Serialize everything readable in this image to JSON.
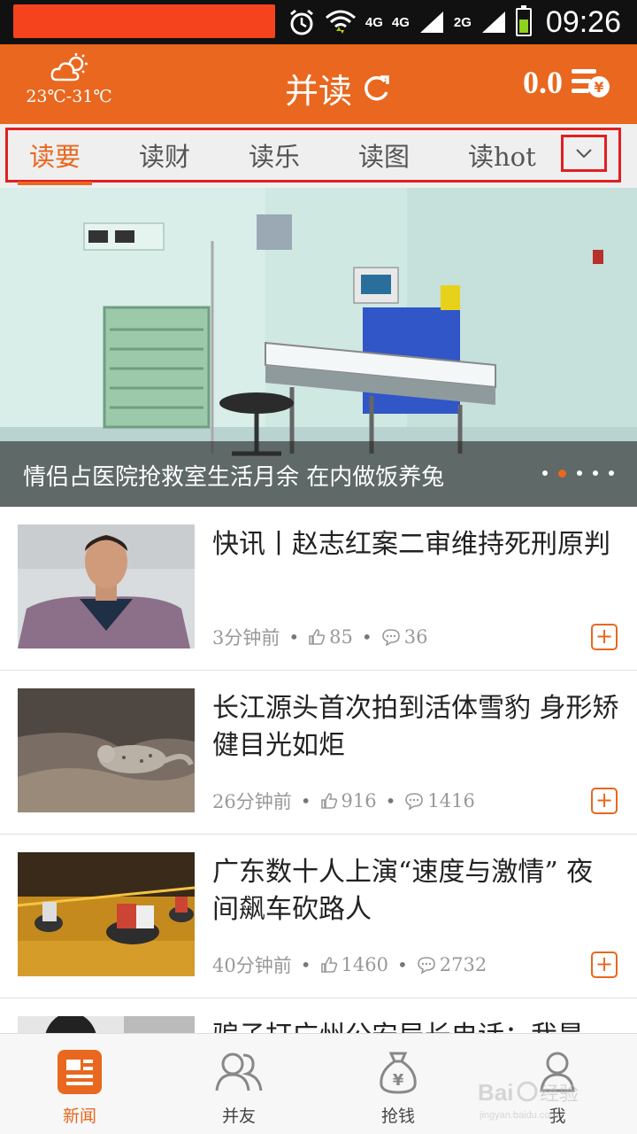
{
  "status_bar": {
    "network_1": "4G",
    "network_2": "4G",
    "network_3": "2G",
    "time": "09:26",
    "icons": [
      "alarm-icon",
      "wifi-icon",
      "signal-icon",
      "battery-icon"
    ]
  },
  "header": {
    "weather_temp": "23℃-31℃",
    "app_title": "并读",
    "balance": "0.0",
    "icons": [
      "weather-icon",
      "refresh-icon",
      "wallet-icon"
    ]
  },
  "tabs": {
    "items": [
      {
        "label": "读要",
        "active": true
      },
      {
        "label": "读财",
        "active": false
      },
      {
        "label": "读乐",
        "active": false
      },
      {
        "label": "读图",
        "active": false
      },
      {
        "label": "读hot",
        "active": false
      }
    ]
  },
  "banner": {
    "title": "情侣占医院抢救室生活月余 在内做饭养兔",
    "slide_count": 5,
    "active_slide": 2
  },
  "news": [
    {
      "title": "快讯丨赵志红案二审维持死刑原判",
      "time": "3分钟前",
      "likes": "85",
      "comments": "36"
    },
    {
      "title": "长江源头首次拍到活体雪豹 身形矫健目光如炬",
      "time": "26分钟前",
      "likes": "916",
      "comments": "1416"
    },
    {
      "title": "广东数十人上演“速度与激情” 夜间飙车砍路人",
      "time": "40分钟前",
      "likes": "1460",
      "comments": "2732"
    },
    {
      "title": "骗子打广州公安局长电话：我是"
    }
  ],
  "bottom_nav": [
    {
      "label": "新闻",
      "icon": "news-icon",
      "active": true
    },
    {
      "label": "并友",
      "icon": "friends-icon",
      "active": false
    },
    {
      "label": "抢钱",
      "icon": "money-bag-icon",
      "active": false
    },
    {
      "label": "我",
      "icon": "profile-icon",
      "active": false
    }
  ],
  "colors": {
    "accent": "#e9671e",
    "status_bar": "#111111",
    "highlight_box": "#e02020",
    "tab_bar": "#efefef"
  }
}
